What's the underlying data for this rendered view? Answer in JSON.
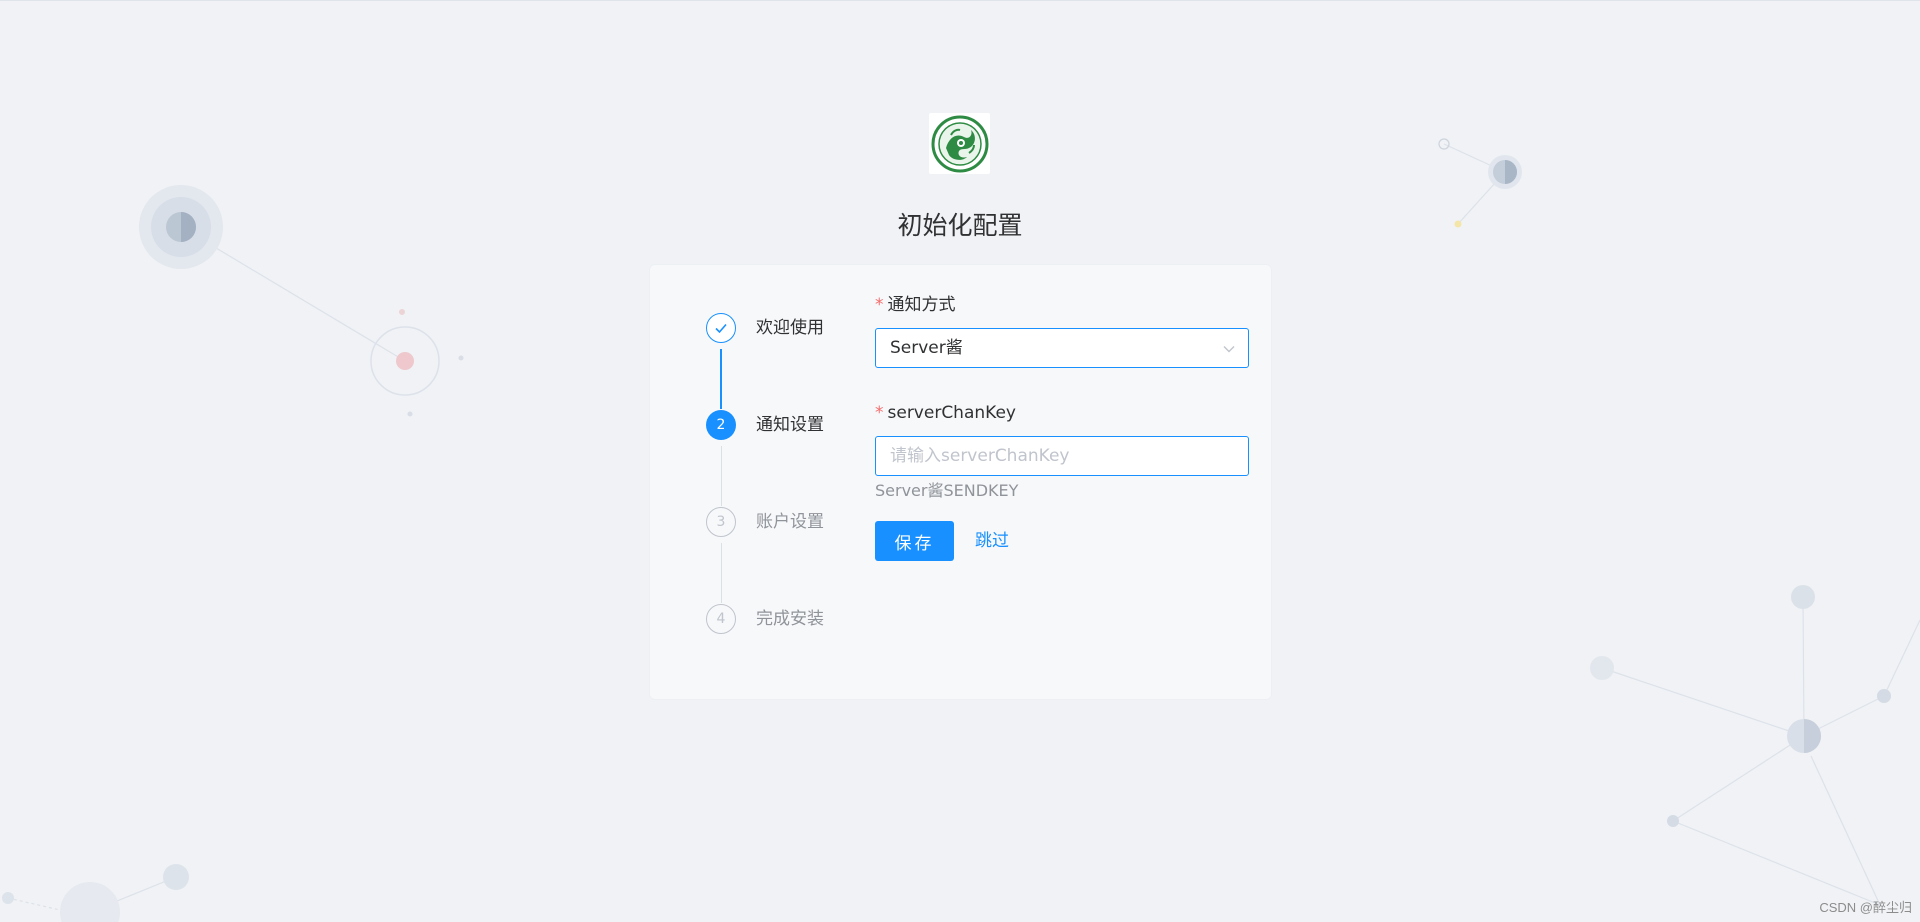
{
  "header": {
    "logo_icon": "dragon-emblem-logo",
    "title": "初始化配置"
  },
  "steps": [
    {
      "label": "欢迎使用",
      "status": "done",
      "icon": "check-icon",
      "number": "1"
    },
    {
      "label": "通知设置",
      "status": "active",
      "number": "2"
    },
    {
      "label": "账户设置",
      "status": "wait",
      "number": "3"
    },
    {
      "label": "完成安装",
      "status": "wait",
      "number": "4"
    }
  ],
  "form": {
    "notify_method": {
      "label": "通知方式",
      "required_mark": "*",
      "value": "Server酱"
    },
    "server_chan_key": {
      "label": "serverChanKey",
      "required_mark": "*",
      "value": "",
      "placeholder": "请输入serverChanKey",
      "help": "Server酱SENDKEY"
    },
    "save_label": "保存",
    "skip_label": "跳过"
  },
  "watermark": "CSDN @醉尘归",
  "colors": {
    "primary": "#1890ff",
    "background": "#f0f2f5",
    "required": "#f56c6c"
  }
}
